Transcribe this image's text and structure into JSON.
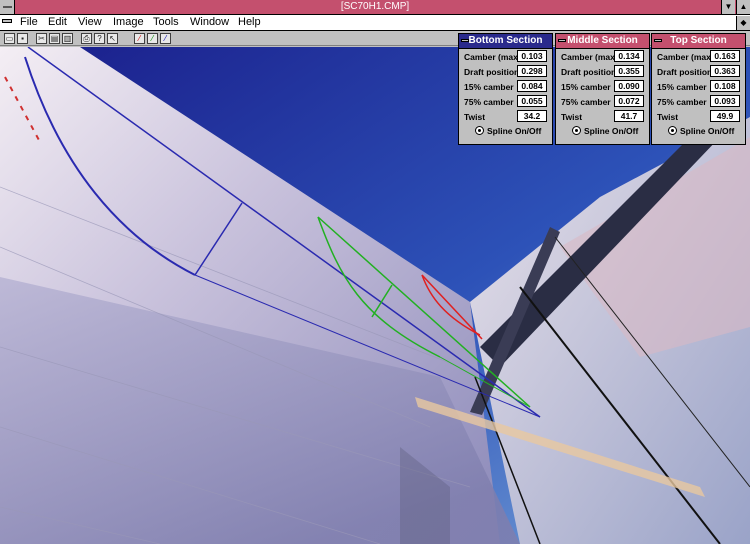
{
  "window": {
    "title": "[SC70H1.CMP]"
  },
  "menu": [
    "File",
    "Edit",
    "View",
    "Image",
    "Tools",
    "Window",
    "Help"
  ],
  "toolbar": [
    "open-icon",
    "save-icon",
    "cut-icon",
    "copy-icon",
    "paste-icon",
    "print-icon",
    "help-icon",
    "select-icon",
    "wand-icon",
    "fill-icon",
    "zoom-icon"
  ],
  "panels": [
    {
      "title": "Bottom Section",
      "camber_max_label": "Camber (max)",
      "camber_max": "0.103",
      "draft_label": "Draft position",
      "draft": "0.298",
      "c15_label": "15% camber",
      "c15": "0.084",
      "c75_label": "75% camber",
      "c75": "0.055",
      "twist_label": "Twist",
      "twist": "34.2",
      "spline_label": "Spline On/Off"
    },
    {
      "title": "Middle Section",
      "camber_max_label": "Camber (max)",
      "camber_max": "0.134",
      "draft_label": "Draft position",
      "draft": "0.355",
      "c15_label": "15% camber",
      "c15": "0.090",
      "c75_label": "75% camber",
      "c75": "0.072",
      "twist_label": "Twist",
      "twist": "41.7",
      "spline_label": "Spline On/Off"
    },
    {
      "title": "Top Section",
      "camber_max_label": "Camber (max)",
      "camber_max": "0.163",
      "draft_label": "Draft position",
      "draft": "0.363",
      "c15_label": "15% camber",
      "c15": "0.108",
      "c75_label": "75% camber",
      "c75": "0.093",
      "twist_label": "Twist",
      "twist": "49.9",
      "spline_label": "Spline On/Off"
    }
  ],
  "colors": {
    "titlebar": "#c4506e",
    "active_tab": "#2a2a8c",
    "bottom_line": "#2a2ab0",
    "middle_line": "#22b022",
    "top_line": "#e02020"
  }
}
